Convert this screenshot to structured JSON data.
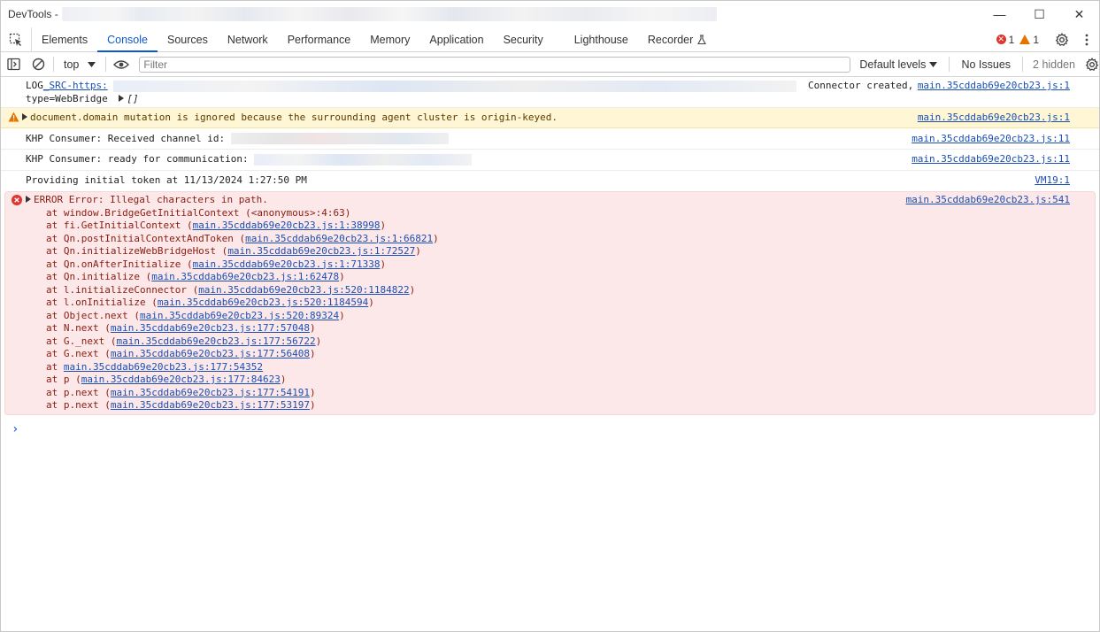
{
  "window": {
    "title": "DevTools -",
    "controls": [
      "—",
      "☐",
      "✕"
    ]
  },
  "tabs": [
    {
      "label": "Elements"
    },
    {
      "label": "Console",
      "active": true
    },
    {
      "label": "Sources"
    },
    {
      "label": "Network"
    },
    {
      "label": "Performance"
    },
    {
      "label": "Memory"
    },
    {
      "label": "Application"
    },
    {
      "label": "Security"
    },
    {
      "label": "Lighthouse"
    },
    {
      "label": "Recorder"
    }
  ],
  "counts": {
    "errors": "1",
    "warnings": "1"
  },
  "toolbar": {
    "context": "top",
    "filter_placeholder": "Filter",
    "levels": "Default levels",
    "issues": "No Issues",
    "hidden": "2 hidden"
  },
  "messages": {
    "log1": {
      "prefix": "LOG",
      "link": "_SRC-https:",
      "right_text": "Connector created,",
      "line2": "type=WebBridge",
      "array": "[]",
      "source": "main.35cddab69e20cb23.js:1"
    },
    "warning": {
      "text": "document.domain mutation is ignored because the surrounding agent cluster is origin-keyed.",
      "source": "main.35cddab69e20cb23.js:1"
    },
    "khp1": {
      "text": "KHP Consumer: Received channel id:",
      "source": "main.35cddab69e20cb23.js:11"
    },
    "khp2": {
      "text": "KHP Consumer: ready for communication:",
      "source": "main.35cddab69e20cb23.js:11"
    },
    "token": {
      "text": "Providing initial token at 11/13/2024 1:27:50 PM",
      "source": "VM19:1"
    },
    "error": {
      "text": "ERROR Error: Illegal characters in path.",
      "source": "main.35cddab69e20cb23.js:541",
      "stack": [
        {
          "fn": "at window.BridgeGetInitialContext (<anonymous>:4:63)",
          "loc": ""
        },
        {
          "fn": "at fi.GetInitialContext (",
          "loc": "main.35cddab69e20cb23.js:1:38998",
          "end": ")"
        },
        {
          "fn": "at Qn.postInitialContextAndToken (",
          "loc": "main.35cddab69e20cb23.js:1:66821",
          "end": ")"
        },
        {
          "fn": "at Qn.initializeWebBridgeHost (",
          "loc": "main.35cddab69e20cb23.js:1:72527",
          "end": ")"
        },
        {
          "fn": "at Qn.onAfterInitialize (",
          "loc": "main.35cddab69e20cb23.js:1:71338",
          "end": ")"
        },
        {
          "fn": "at Qn.initialize (",
          "loc": "main.35cddab69e20cb23.js:1:62478",
          "end": ")"
        },
        {
          "fn": "at l.initializeConnector (",
          "loc": "main.35cddab69e20cb23.js:520:1184822",
          "end": ")"
        },
        {
          "fn": "at l.onInitialize (",
          "loc": "main.35cddab69e20cb23.js:520:1184594",
          "end": ")"
        },
        {
          "fn": "at Object.next (",
          "loc": "main.35cddab69e20cb23.js:520:89324",
          "end": ")"
        },
        {
          "fn": "at N.next (",
          "loc": "main.35cddab69e20cb23.js:177:57048",
          "end": ")"
        },
        {
          "fn": "at G._next (",
          "loc": "main.35cddab69e20cb23.js:177:56722",
          "end": ")"
        },
        {
          "fn": "at G.next (",
          "loc": "main.35cddab69e20cb23.js:177:56408",
          "end": ")"
        },
        {
          "fn": "at ",
          "loc": "main.35cddab69e20cb23.js:177:54352",
          "end": ""
        },
        {
          "fn": "at p (",
          "loc": "main.35cddab69e20cb23.js:177:84623",
          "end": ")"
        },
        {
          "fn": "at p.next (",
          "loc": "main.35cddab69e20cb23.js:177:54191",
          "end": ")"
        },
        {
          "fn": "at p.next (",
          "loc": "main.35cddab69e20cb23.js:177:53197",
          "end": ")"
        }
      ]
    }
  },
  "prompt": "›"
}
